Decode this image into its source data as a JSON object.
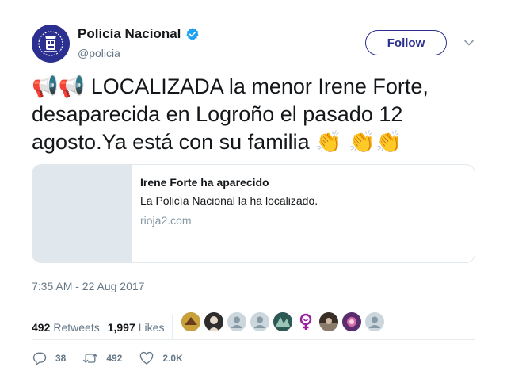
{
  "user": {
    "display_name": "Policía Nacional",
    "handle": "@policia",
    "avatar_icon": "police-crest-icon",
    "verified_icon": "verified-badge-icon",
    "brand_color": "#2b2f8f"
  },
  "follow_label": "Follow",
  "tweet": {
    "emoji_prefix": "📢📢",
    "text": "LOCALIZADA la menor Irene Forte, desaparecida en Logroño el pasado 12 agosto.Ya está con su familia",
    "emoji_suffix": "👏 👏👏"
  },
  "card": {
    "title": "Irene Forte ha aparecido",
    "description": "La Policía Nacional la ha localizado.",
    "domain": "rioja2.com"
  },
  "timestamp": "7:35 AM - 22 Aug 2017",
  "stats": {
    "retweets_count": "492",
    "retweets_label": "Retweets",
    "likes_count": "1,997",
    "likes_label": "Likes"
  },
  "actions": {
    "reply_count": "38",
    "retweet_count": "492",
    "like_count": "2.0K"
  }
}
